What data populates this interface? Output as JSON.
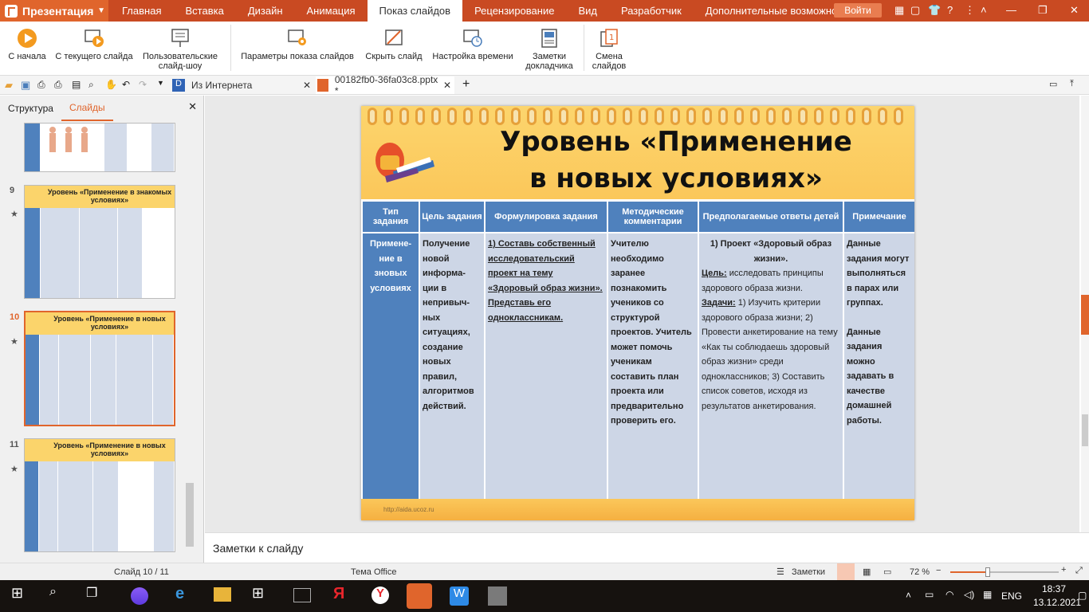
{
  "app": {
    "title": "Презентация"
  },
  "menu": [
    "Главная",
    "Вставка",
    "Дизайн",
    "Анимация",
    "Показ слайдов",
    "Рецензирование",
    "Вид",
    "Разработчик",
    "Дополнительные возможности"
  ],
  "login": "Войти",
  "ribbon": {
    "from_start": "С начала",
    "from_current": "С текущего слайда",
    "custom": "Пользовательские слайд-шоу",
    "settings": "Параметры показа слайдов",
    "hide": "Скрыть слайд",
    "timing": "Настройка времени",
    "notes": "Заметки докладчика",
    "switch": "Смена слайдов"
  },
  "tabs": {
    "internet": "Из Интернета",
    "file": "00182fb0-36fa03c8.pptx *"
  },
  "panel": {
    "structure": "Структура",
    "slides": "Слайды"
  },
  "thumbs": [
    {
      "num": "9",
      "title": "Уровень «Применение в знакомых условиях»"
    },
    {
      "num": "10",
      "title": "Уровень «Применение в новых условиях»"
    },
    {
      "num": "11",
      "title": "Уровень «Применение в новых условиях»"
    }
  ],
  "slide": {
    "title": "Уровень «Применение в новых условиях»",
    "headers": [
      "Тип задания",
      "Цель задания",
      "Формулировка задания",
      "Методические комментарии",
      "Предполагаемые ответы детей",
      "Примечание"
    ],
    "col1": "Примене-ние в зновых условиях",
    "col2": "Получение новой информа-ции в непривыч-ных ситуациях, создание новых правил, алгоритмов действий.",
    "col3": "1) Составь собственный исследовательский проект на тему «Здоровый образ жизни». Представь его одноклассникам.",
    "col4": "Учителю необходимо заранее познакомить учеников со структурой проектов. Учитель может помочь ученикам составить план проекта или предварительно проверить его.",
    "col5_title": "1) Проект «Здоровый образ жизни».",
    "col5_goal_label": "Цель:",
    "col5_goal": " исследовать принципы здорового образа жизни.",
    "col5_tasks_label": "Задачи:",
    "col5_tasks": " 1) Изучить критерии здорового образа жизни; 2) Провести анкетирование на тему «Как ты соблюдаешь здоровый образ жизни» среди одноклассников; 3) Составить список советов, исходя из результатов анкетирования.",
    "col6a": "Данные задания могут выполняться в парах или группах.",
    "col6b": "Данные задания можно задавать в качестве домашней работы.",
    "footer": "http://aida.ucoz.ru"
  },
  "notes": "Заметки к слайду",
  "status": {
    "slide": "Слайд 10 / 11",
    "theme": "Тема Office",
    "notes": "Заметки",
    "zoom": "72 %"
  },
  "taskbar": {
    "lang": "ENG",
    "time": "18:37",
    "date": "13.12.2021"
  }
}
